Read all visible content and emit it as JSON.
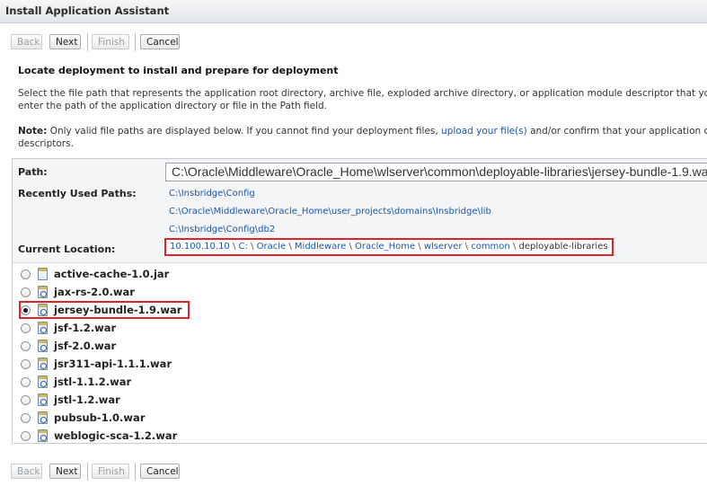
{
  "title": "Install Application Assistant",
  "buttons": {
    "back": "Back",
    "next": "Next",
    "finish": "Finish",
    "cancel": "Cancel"
  },
  "heading": "Locate deployment to install and prepare for deployment",
  "description_line1": "Select the file path that represents the application root directory, archive file, exploded archive directory, or application module descriptor that you want t",
  "description_line2": "enter the path of the application directory or file in the Path field.",
  "note": {
    "label": "Note:",
    "text_before": " Only valid file paths are displayed below. If you cannot find your deployment files, ",
    "link": "upload your file(s)",
    "text_after": " and/or confirm that your application contains",
    "line2": "descriptors."
  },
  "path": {
    "label": "Path:",
    "value": "C:\\Oracle\\Middleware\\Oracle_Home\\wlserver\\common\\deployable-libraries\\jersey-bundle-1.9.war"
  },
  "recent": {
    "label": "Recently Used Paths:",
    "items": [
      "C:\\Insbridge\\Config",
      "C:\\Oracle\\Middleware\\Oracle_Home\\user_projects\\domains\\Insbridge\\lib",
      "C:\\Insbridge\\Config\\db2"
    ]
  },
  "current_location": {
    "label": "Current Location:",
    "crumbs": [
      "10.100.10.10",
      "C:",
      "Oracle",
      "Middleware",
      "Oracle_Home",
      "wlserver",
      "common"
    ],
    "separator": " \\ ",
    "last": "deployable-libraries"
  },
  "files": [
    {
      "name": "active-cache-1.0.jar",
      "type": "jar",
      "selected": false
    },
    {
      "name": "jax-rs-2.0.war",
      "type": "war",
      "selected": false
    },
    {
      "name": "jersey-bundle-1.9.war",
      "type": "war",
      "selected": true
    },
    {
      "name": "jsf-1.2.war",
      "type": "war",
      "selected": false
    },
    {
      "name": "jsf-2.0.war",
      "type": "war",
      "selected": false
    },
    {
      "name": "jsr311-api-1.1.1.war",
      "type": "war",
      "selected": false
    },
    {
      "name": "jstl-1.1.2.war",
      "type": "war",
      "selected": false
    },
    {
      "name": "jstl-1.2.war",
      "type": "war",
      "selected": false
    },
    {
      "name": "pubsub-1.0.war",
      "type": "war",
      "selected": false
    },
    {
      "name": "weblogic-sca-1.2.war",
      "type": "war",
      "selected": false
    }
  ],
  "colors": {
    "link": "#1a57a6",
    "highlight_border": "#d9262c"
  }
}
